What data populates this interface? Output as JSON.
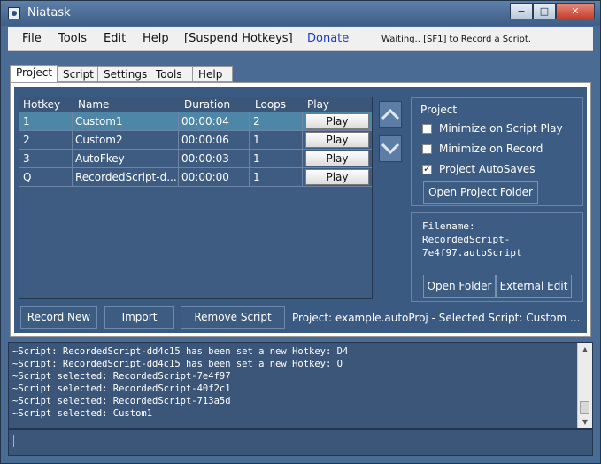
{
  "window": {
    "title": "Niatask",
    "minimize_glyph": "−",
    "maximize_glyph": "□",
    "close_glyph": "✕"
  },
  "menubar": {
    "items": [
      "File",
      "Tools",
      "Edit",
      "Help",
      "[Suspend Hotkeys]",
      "Donate"
    ],
    "status": "Waiting.. [SF1] to Record a Script."
  },
  "tabs": [
    "Project",
    "Script",
    "Settings",
    "Tools",
    "Help"
  ],
  "grid": {
    "headers": [
      "Hotkey",
      "Name",
      "Duration",
      "Loops",
      "Play"
    ],
    "rows": [
      {
        "hotkey": "1",
        "name": "Custom1",
        "duration": "00:00:04",
        "loops": "2",
        "play": "Play"
      },
      {
        "hotkey": "2",
        "name": "Custom2",
        "duration": "00:00:06",
        "loops": "1",
        "play": "Play"
      },
      {
        "hotkey": "3",
        "name": "AutoFkey",
        "duration": "00:00:03",
        "loops": "1",
        "play": "Play"
      },
      {
        "hotkey": "Q",
        "name": "RecordedScript-d...",
        "duration": "00:00:00",
        "loops": "1",
        "play": "Play"
      }
    ],
    "selected_row": 0
  },
  "project_group": {
    "title": "Project",
    "minimize_on_play": {
      "label": "Minimize on Script Play",
      "checked": false
    },
    "minimize_on_record": {
      "label": "Minimize on Record",
      "checked": false
    },
    "autosaves": {
      "label": "Project AutoSaves",
      "checked": true
    },
    "open_folder": "Open Project Folder"
  },
  "file_group": {
    "filename_label": "Filename:",
    "filename_line1": "RecordedScript-",
    "filename_line2": "7e4f97.autoScript",
    "open_folder": "Open Folder",
    "external_edit": "External Edit"
  },
  "actions": {
    "record_new": "Record New",
    "import": "Import",
    "remove_script": "Remove Script"
  },
  "project_status": "Project: example.autoProj - Selected Script: Custom ...",
  "log": [
    "~Script: RecordedScript-dd4c15 has been set a new Hotkey: D4",
    "~Script: RecordedScript-dd4c15 has been set a new Hotkey: Q",
    "~Script selected: RecordedScript-7e4f97",
    "~Script selected: RecordedScript-40f2c1",
    "~Script selected: RecordedScript-713a5d",
    "~Script selected: Custom1"
  ],
  "command_input": {
    "value": ""
  },
  "colors": {
    "accent": "#4d86a7",
    "panel": "#3b5a81",
    "donate": "#1a3cc8"
  },
  "icons": [
    "app-icon",
    "arrow-up-icon",
    "arrow-down-icon",
    "checkbox-checked-icon"
  ]
}
